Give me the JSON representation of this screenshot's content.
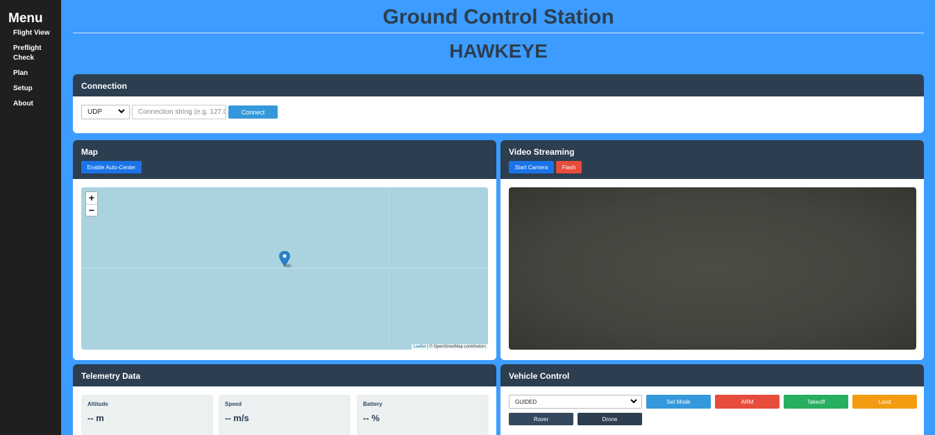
{
  "sidebar": {
    "title": "Menu",
    "items": [
      {
        "label": "Flight View"
      },
      {
        "label": "Preflight Check"
      },
      {
        "label": "Plan"
      },
      {
        "label": "Setup"
      },
      {
        "label": "About"
      }
    ]
  },
  "header": {
    "title": "Ground Control Station",
    "subtitle": "HAWKEYE"
  },
  "connection": {
    "heading": "Connection",
    "protocol": "UDP",
    "placeholder": "Connection string (e.g. 127.0",
    "connect_label": "Connect"
  },
  "map": {
    "heading": "Map",
    "auto_center_label": "Enable Auto-Center",
    "zoom_in": "+",
    "zoom_out": "−",
    "attribution_link": "Leaflet",
    "attribution_text": " | © OpenStreetMap contributors"
  },
  "video": {
    "heading": "Video Streaming",
    "start_label": "Start Camera",
    "flash_label": "Flash"
  },
  "telemetry": {
    "heading": "Telemetry Data",
    "tiles": [
      {
        "label": "Altitude",
        "value": "-- m"
      },
      {
        "label": "Speed",
        "value": "-- m/s"
      },
      {
        "label": "Battery",
        "value": "-- %"
      }
    ]
  },
  "vehicle": {
    "heading": "Vehicle Control",
    "mode": "GUIDED",
    "set_mode_label": "Set Mode",
    "arm_label": "ARM",
    "takeoff_label": "Takeoff",
    "land_label": "Land",
    "rover_label": "Rover",
    "drone_label": "Drone"
  },
  "colors": {
    "background": "#3c9cff",
    "sidebar": "#1f1f1f",
    "card_header": "#2c3e50",
    "primary": "#1a73e8",
    "danger": "#e74c3c",
    "success": "#27ae60",
    "warning": "#f39c12"
  }
}
